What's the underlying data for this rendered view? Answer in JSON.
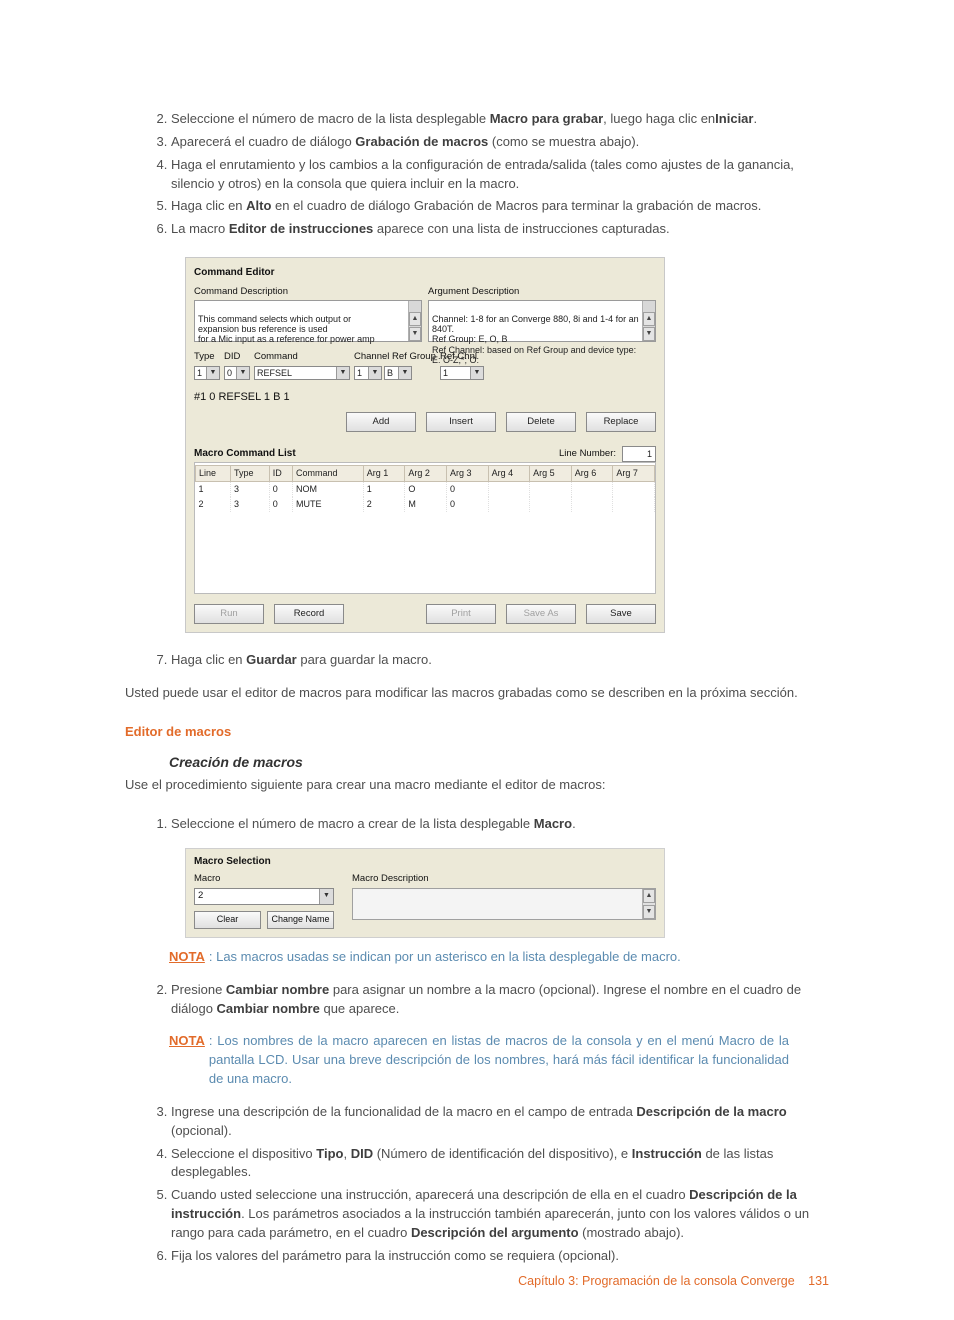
{
  "steps_a": {
    "start": 2,
    "items": [
      {
        "pre": "Seleccione el número de macro de la lista desplegable ",
        "b1": "Macro para grabar",
        "mid": ", luego haga clic en",
        "b2": "Iniciar",
        "post": "."
      },
      {
        "pre": "Aparecerá el cuadro de diálogo ",
        "b1": "Grabación de macros",
        "mid": " (como se muestra abajo).",
        "b2": "",
        "post": ""
      },
      {
        "pre": "Haga el enrutamiento y los cambios a la configuración de entrada/salida (tales como ajustes de la ganancia, silencio y otros) en la consola que quiera incluir en la macro.",
        "b1": "",
        "mid": "",
        "b2": "",
        "post": ""
      },
      {
        "pre": "Haga clic en ",
        "b1": "Alto",
        "mid": " en el cuadro de diálogo Grabación de Macros para terminar la grabación de macros.",
        "b2": "",
        "post": ""
      },
      {
        "pre": "La macro ",
        "b1": "Editor de instrucciones",
        "mid": " aparece con una lista de instrucciones capturadas.",
        "b2": "",
        "post": ""
      }
    ],
    "step7": {
      "pre": "Haga clic en ",
      "b1": "Guardar",
      "mid": " para guardar la macro.",
      "b2": "",
      "post": ""
    }
  },
  "editor": {
    "title": "Command Editor",
    "cmd_desc_label": "Command Description",
    "arg_desc_label": "Argument Description",
    "cmd_desc_text": "This command selects which output or\nexpansion bus reference is used\nfor a Mic input as a reference for power amp",
    "arg_desc_text": "Channel: 1-8 for an Converge 880, 8i and 1-4 for an 840T.\nRef Group: E, O, B\nRef Channel: based on Ref Group and device type: E: O-Z,*; O:",
    "labels": {
      "type": "Type",
      "did": "DID",
      "command": "Command",
      "channelrefgroup": "Channel Ref Group",
      "refchan": "Ref Chnl"
    },
    "values": {
      "type": "1",
      "did": "0",
      "command": "REFSEL",
      "ch": "1",
      "rg": "B",
      "refchnl": "1"
    },
    "big_line": "#1 0 REFSEL 1 B 1",
    "btns": {
      "add": "Add",
      "insert": "Insert",
      "delete": "Delete",
      "replace": "Replace"
    },
    "macro_list_title": "Macro Command List",
    "line_number_label": "Line Number:",
    "line_number": "1",
    "table": {
      "headers": [
        "Line",
        "Type",
        "ID",
        "Command",
        "Arg 1",
        "Arg 2",
        "Arg 3",
        "Arg 4",
        "Arg 5",
        "Arg 6",
        "Arg 7"
      ],
      "rows": [
        [
          "1",
          "3",
          "0",
          "NOM",
          "1",
          "O",
          "0",
          "",
          "",
          "",
          ""
        ],
        [
          "2",
          "3",
          "0",
          "MUTE",
          "2",
          "M",
          "0",
          "",
          "",
          "",
          ""
        ]
      ]
    },
    "bottom": {
      "run": "Run",
      "record": "Record",
      "print": "Print",
      "saveas": "Save As",
      "save": "Save"
    }
  },
  "para_after": "Usted puede usar el editor de macros para modificar las macros grabadas como se describen en la próxima sección.",
  "section_h": "Editor de macros",
  "sub_h": "Creación de macros",
  "para_procedure": "Use el procedimiento siguiente para crear una macro mediante el editor de macros:",
  "steps_b": {
    "start": 1,
    "item1": {
      "pre": "Seleccione el número de macro a crear de la lista desplegable ",
      "b": "Macro",
      "post": "."
    },
    "item2": {
      "pre": "Presione ",
      "b1": "Cambiar nombre",
      "mid": " para asignar un nombre a la macro (opcional). Ingrese el nombre en el cuadro de diálogo ",
      "b2": "Cambiar nombre",
      "post": " que aparece."
    },
    "item3": {
      "pre": "Ingrese una descripción de la funcionalidad de la macro en el campo de entrada ",
      "b1": "Descripción de la macro",
      "mid": " (opcional).",
      "b2": "",
      "post": ""
    },
    "item4": {
      "pre": "Seleccione el dispositivo ",
      "b1": "Tipo",
      "mid1": ", ",
      "b2": "DID",
      "mid2": " (Número de identificación del dispositivo), e ",
      "b3": "Instrucción",
      "post": " de las listas desplegables."
    },
    "item5": {
      "pre": "Cuando usted seleccione una instrucción, aparecerá una descripción de ella en el cuadro ",
      "b1": "Descripción de la instrucción",
      "mid": ". Los parámetros asociados a la instrucción también aparecerán, junto con los valores válidos o un rango para cada parámetro, en el cuadro ",
      "b2": "Descripción del argumento",
      "post": " (mostrado abajo)."
    },
    "item6": {
      "pre": "Fija los valores del parámetro para la instrucción como se requiera (opcional).",
      "b1": "",
      "mid": "",
      "b2": "",
      "post": ""
    }
  },
  "nota": {
    "label": "NOTA",
    "t1": ": Las macros usadas se indican por un asterisco en la lista desplegable de macro.",
    "t2": ": Los nombres de la macro aparecen en listas de macros de la consola y en el menú Macro de la pantalla LCD. Usar una breve descripción de los nombres, hará más fácil identificar la funcionalidad de una macro."
  },
  "macro_selection": {
    "title": "Macro Selection",
    "macro_label": "Macro",
    "desc_label": "Macro Description",
    "value": "2",
    "clear": "Clear",
    "change": "Change Name"
  },
  "footer": {
    "chapter": "Capítulo 3: Programación de la consola Converge",
    "page": "131"
  }
}
